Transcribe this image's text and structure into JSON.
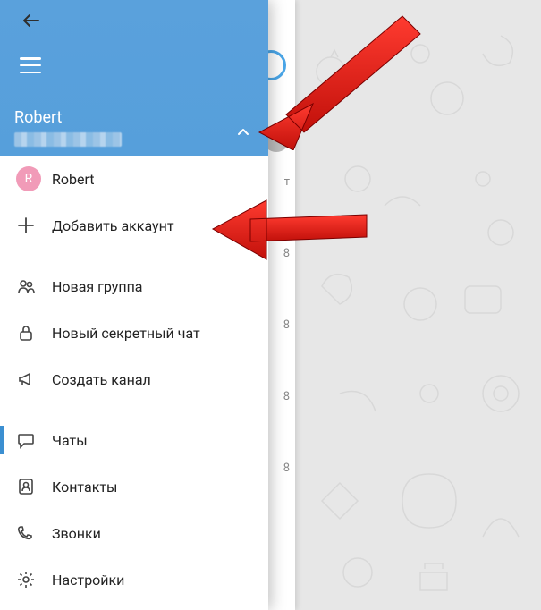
{
  "header": {
    "name": "Robert"
  },
  "accounts": {
    "current": {
      "initial": "R",
      "name": "Robert"
    },
    "add_label": "Добавить аккаунт"
  },
  "menu": {
    "new_group": "Новая группа",
    "new_secret_chat": "Новый секретный чат",
    "new_channel": "Создать канал",
    "chats": "Чаты",
    "contacts": "Контакты",
    "calls": "Звонки",
    "settings": "Настройки"
  },
  "chat_strip": {
    "badges": [
      "т",
      "8",
      "8",
      "8",
      "8"
    ]
  }
}
